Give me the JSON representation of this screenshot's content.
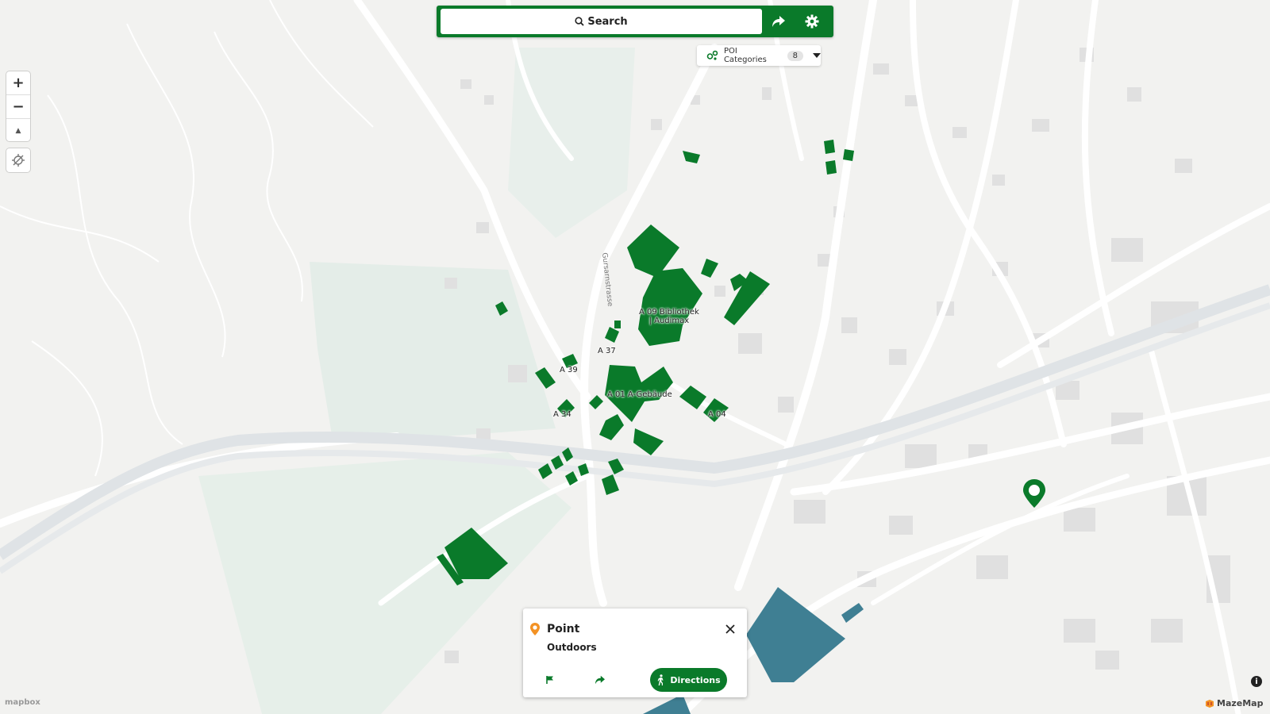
{
  "toolbar": {
    "search_label": "Search",
    "share_icon": "share-arrow-icon",
    "settings_icon": "gear-icon"
  },
  "poi_filter": {
    "label": "POI Categories",
    "count": "8"
  },
  "map_controls": {
    "zoom_in": "+",
    "zoom_out": "−",
    "compass": "▲"
  },
  "map_labels": {
    "a09": [
      "A 09 Bibliothek",
      "| Audimax"
    ],
    "a37": "A 37",
    "a39": "A 39",
    "a01": "A 01 A-Gebäude",
    "a34": "A 34",
    "a04": "A 04",
    "street": "Gursarnstrasse"
  },
  "point_card": {
    "title": "Point",
    "subtitle": "Outdoors",
    "directions_label": "Directions"
  },
  "attribution": {
    "mapbox": "mapbox",
    "mazemap": "MazeMap"
  },
  "colors": {
    "brand_green": "#0a7a2a",
    "building_green": "#0a7a2a",
    "water_teal": "#3f7f93",
    "road": "#ffffff",
    "railway": "#dde1e4",
    "park": "#e6efe9"
  }
}
